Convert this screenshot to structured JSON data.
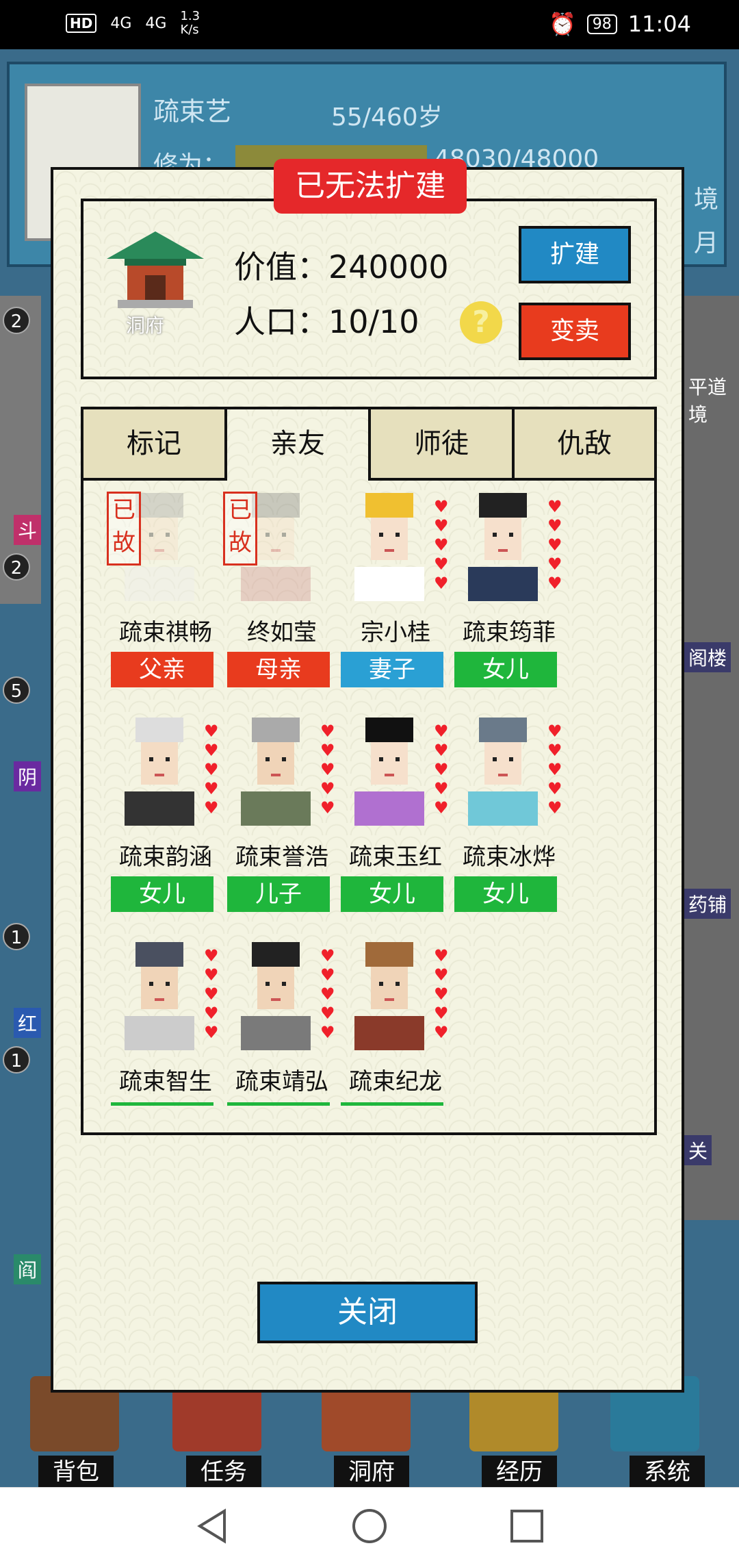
{
  "status_bar": {
    "hd": "HD",
    "signal1": "4G",
    "signal2": "4G",
    "speed_value": "1.3",
    "speed_unit": "K/s",
    "battery": "98",
    "time": "11:04"
  },
  "background": {
    "char_name": "疏束艺",
    "age": "55/460岁",
    "cultivation_label": "修为：",
    "cultivation_value": "48030/48000",
    "right_labels": [
      "境",
      "月"
    ],
    "side_labels": [
      "斗",
      "阴",
      "红",
      "阎"
    ],
    "side_numbers": [
      "2",
      "2",
      "5",
      "1",
      "1"
    ],
    "right_side_labels": [
      "平道",
      "境",
      "阁楼",
      "药铺",
      "关"
    ]
  },
  "bottom_nav": {
    "items": [
      "背包",
      "任务",
      "洞府",
      "经历",
      "系统"
    ]
  },
  "modal": {
    "banner": "已无法扩建",
    "house_label": "洞府",
    "value_label": "价值：",
    "value": "240000",
    "population_label": "人口：",
    "population": "10/10",
    "help_icon": "?",
    "expand_button": "扩建",
    "sell_button": "变卖",
    "tabs": [
      "标记",
      "亲友",
      "师徒",
      "仇敌"
    ],
    "active_tab": "亲友",
    "deceased_mark": "已故",
    "close_button": "关闭",
    "people": [
      {
        "name": "疏束祺畅",
        "role": "父亲",
        "role_color": "#e83b1e",
        "deceased": true
      },
      {
        "name": "终如莹",
        "role": "母亲",
        "role_color": "#e83b1e",
        "deceased": true
      },
      {
        "name": "宗小桂",
        "role": "妻子",
        "role_color": "#2aa0d4",
        "deceased": false
      },
      {
        "name": "疏束筠菲",
        "role": "女儿",
        "role_color": "#1fb63c",
        "deceased": false
      },
      {
        "name": "疏束韵涵",
        "role": "女儿",
        "role_color": "#1fb63c",
        "deceased": false
      },
      {
        "name": "疏束誉浩",
        "role": "儿子",
        "role_color": "#1fb63c",
        "deceased": false
      },
      {
        "name": "疏束玉红",
        "role": "女儿",
        "role_color": "#1fb63c",
        "deceased": false
      },
      {
        "name": "疏束冰烨",
        "role": "女儿",
        "role_color": "#1fb63c",
        "deceased": false
      },
      {
        "name": "疏束智生",
        "role": "",
        "role_color": "#1fb63c",
        "deceased": false
      },
      {
        "name": "疏束靖弘",
        "role": "",
        "role_color": "#1fb63c",
        "deceased": false
      },
      {
        "name": "疏束纪龙",
        "role": "",
        "role_color": "#1fb63c",
        "deceased": false
      }
    ]
  },
  "colors": {
    "banner_red": "#e5282a",
    "button_blue": "#2189c4",
    "button_red": "#e83b1e",
    "role_green": "#1fb63c",
    "modal_bg": "#f4f4e2"
  }
}
